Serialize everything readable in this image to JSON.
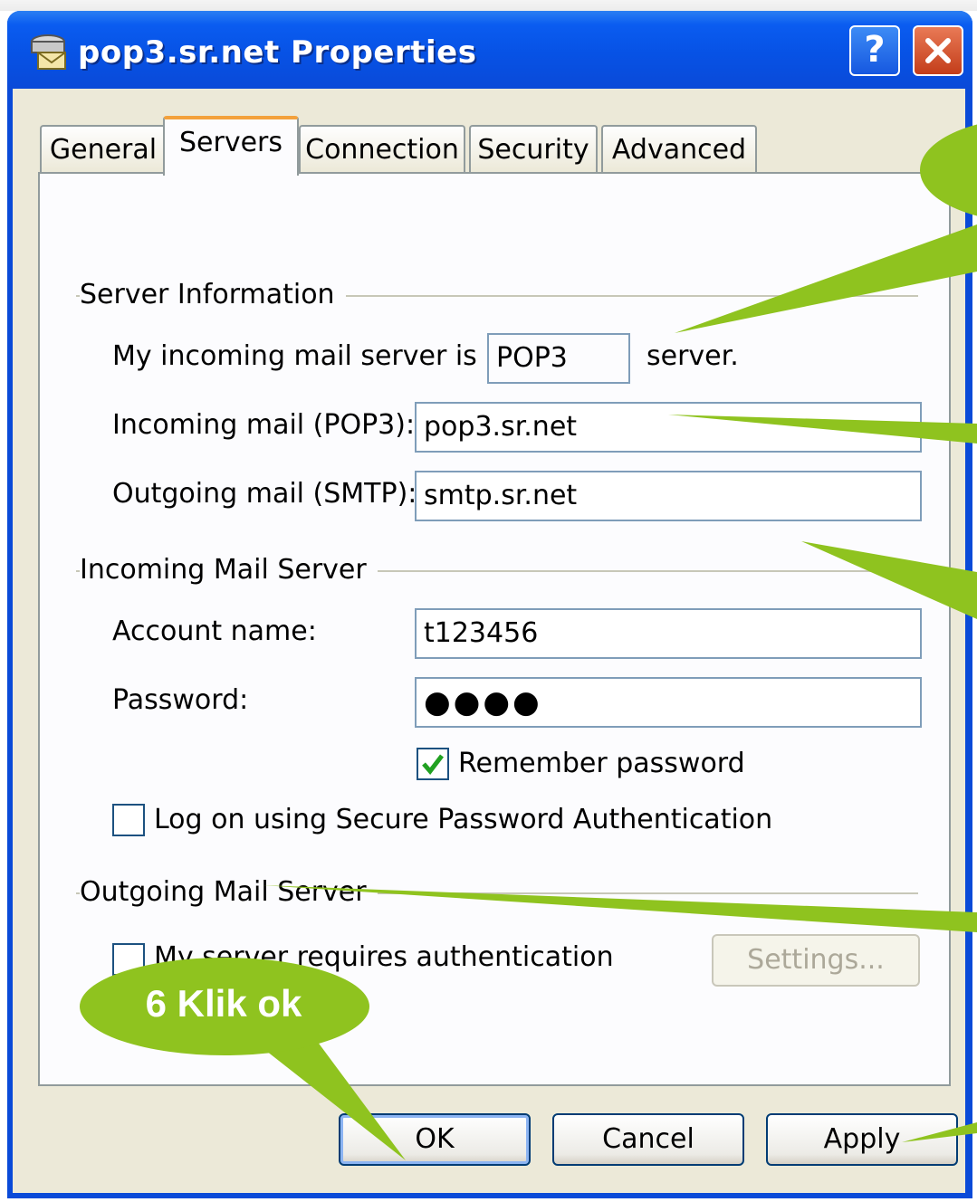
{
  "window": {
    "title": "pop3.sr.net Properties"
  },
  "titlebar_buttons": {
    "help": "?",
    "close": "✕"
  },
  "tabs": [
    {
      "label": "General"
    },
    {
      "label": "Servers"
    },
    {
      "label": "Connection"
    },
    {
      "label": "Security"
    },
    {
      "label": "Advanced"
    }
  ],
  "server_information": {
    "group_label": "Server Information",
    "incoming_type_prefix": "My incoming mail server is a",
    "incoming_type_value": "POP3",
    "incoming_type_suffix": "server.",
    "incoming_label": "Incoming mail (POP3):",
    "incoming_value": "pop3.sr.net",
    "outgoing_label": "Outgoing mail (SMTP):",
    "outgoing_value": "smtp.sr.net"
  },
  "incoming_mail_server": {
    "group_label": "Incoming Mail Server",
    "account_label": "Account name:",
    "account_value": "t123456",
    "password_label": "Password:",
    "password_value": "●●●●",
    "remember_label": "Remember password",
    "remember_checked": true,
    "spa_label": "Log on using Secure Password Authentication",
    "spa_checked": false
  },
  "outgoing_mail_server": {
    "group_label": "Outgoing Mail Server",
    "auth_label": "My server requires authentication",
    "auth_checked": false,
    "settings_label": "Settings..."
  },
  "buttons": {
    "ok": "OK",
    "cancel": "Cancel",
    "apply": "Apply"
  },
  "callout": {
    "text": "6 Klik ok",
    "color": "#8fc31f"
  },
  "colors": {
    "titlebar": "#0a4ad8",
    "dialog_bg": "#ece9d8",
    "tab_accent": "#f3a13c"
  }
}
